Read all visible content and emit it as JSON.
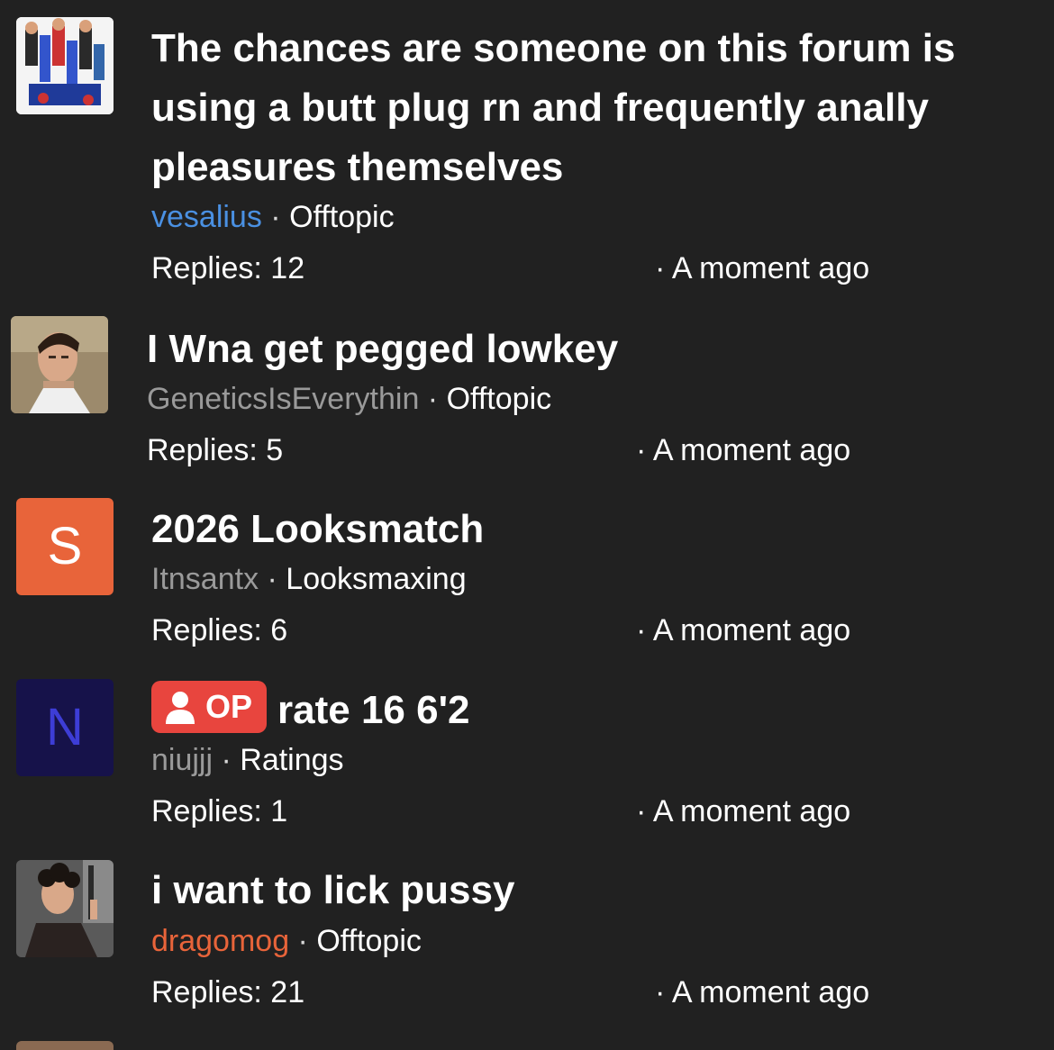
{
  "threads": [
    {
      "avatar": {
        "kind": "image",
        "icon": "cartoon-group-avatar-icon"
      },
      "title": "The chances are someone on this forum is using a butt plug rn and frequently anally pleasures themselves",
      "author": "vesalius",
      "author_color": "#4a90e2",
      "separator": " · ",
      "forum": "Offtopic",
      "replies": "Replies: 12",
      "time": "· A moment ago"
    },
    {
      "avatar": {
        "kind": "image",
        "icon": "man-portrait-avatar-icon"
      },
      "title": "I Wna get pegged lowkey",
      "author": "GeneticsIsEverythin",
      "author_color": "#9a9a9a",
      "separator": " · ",
      "forum": "Offtopic",
      "replies": "Replies: 5",
      "time": "· A moment ago"
    },
    {
      "avatar": {
        "kind": "letter",
        "letter": "S",
        "bg": "#e8643a",
        "fg": "#ffffff"
      },
      "title": "2026 Looksmatch",
      "author": "Itnsantx",
      "author_color": "#9a9a9a",
      "separator": " · ",
      "forum": "Looksmaxing",
      "replies": "Replies: 6",
      "time": "· A moment ago"
    },
    {
      "avatar": {
        "kind": "letter",
        "letter": "N",
        "bg": "#16124a",
        "fg": "#3d3dd6"
      },
      "badge": {
        "label": "OP",
        "icon": "user-icon",
        "color": "#e8453e"
      },
      "title": "rate 16 6'2",
      "author": "niujjj",
      "author_color": "#9a9a9a",
      "separator": " · ",
      "forum": "Ratings",
      "replies": "Replies: 1",
      "time": "· A moment ago"
    },
    {
      "avatar": {
        "kind": "image",
        "icon": "man-curly-hair-avatar-icon"
      },
      "title": "i want to lick pussy",
      "author": "dragomog",
      "author_color": "#e8643a",
      "separator": " · ",
      "forum": "Offtopic",
      "replies": "Replies: 21",
      "time": "· A moment ago"
    }
  ]
}
